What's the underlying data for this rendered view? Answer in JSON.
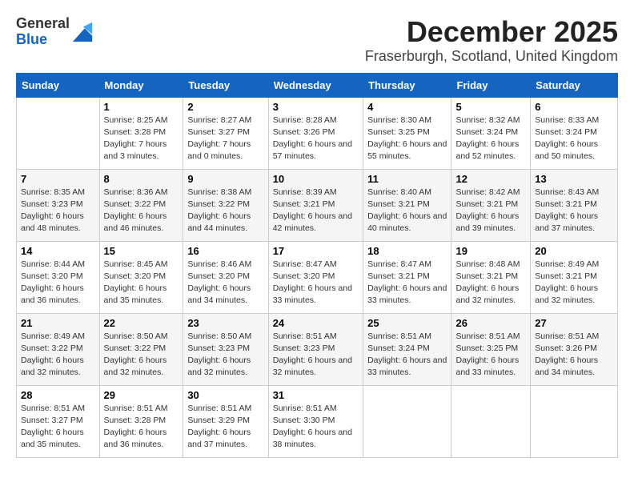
{
  "header": {
    "logo_general": "General",
    "logo_blue": "Blue",
    "title": "December 2025",
    "subtitle": "Fraserburgh, Scotland, United Kingdom"
  },
  "weekdays": [
    "Sunday",
    "Monday",
    "Tuesday",
    "Wednesday",
    "Thursday",
    "Friday",
    "Saturday"
  ],
  "weeks": [
    [
      {
        "day": "",
        "sunrise": "",
        "sunset": "",
        "daylight": ""
      },
      {
        "day": "1",
        "sunrise": "8:25 AM",
        "sunset": "3:28 PM",
        "daylight": "7 hours and 3 minutes."
      },
      {
        "day": "2",
        "sunrise": "8:27 AM",
        "sunset": "3:27 PM",
        "daylight": "7 hours and 0 minutes."
      },
      {
        "day": "3",
        "sunrise": "8:28 AM",
        "sunset": "3:26 PM",
        "daylight": "6 hours and 57 minutes."
      },
      {
        "day": "4",
        "sunrise": "8:30 AM",
        "sunset": "3:25 PM",
        "daylight": "6 hours and 55 minutes."
      },
      {
        "day": "5",
        "sunrise": "8:32 AM",
        "sunset": "3:24 PM",
        "daylight": "6 hours and 52 minutes."
      },
      {
        "day": "6",
        "sunrise": "8:33 AM",
        "sunset": "3:24 PM",
        "daylight": "6 hours and 50 minutes."
      }
    ],
    [
      {
        "day": "7",
        "sunrise": "8:35 AM",
        "sunset": "3:23 PM",
        "daylight": "6 hours and 48 minutes."
      },
      {
        "day": "8",
        "sunrise": "8:36 AM",
        "sunset": "3:22 PM",
        "daylight": "6 hours and 46 minutes."
      },
      {
        "day": "9",
        "sunrise": "8:38 AM",
        "sunset": "3:22 PM",
        "daylight": "6 hours and 44 minutes."
      },
      {
        "day": "10",
        "sunrise": "8:39 AM",
        "sunset": "3:21 PM",
        "daylight": "6 hours and 42 minutes."
      },
      {
        "day": "11",
        "sunrise": "8:40 AM",
        "sunset": "3:21 PM",
        "daylight": "6 hours and 40 minutes."
      },
      {
        "day": "12",
        "sunrise": "8:42 AM",
        "sunset": "3:21 PM",
        "daylight": "6 hours and 39 minutes."
      },
      {
        "day": "13",
        "sunrise": "8:43 AM",
        "sunset": "3:21 PM",
        "daylight": "6 hours and 37 minutes."
      }
    ],
    [
      {
        "day": "14",
        "sunrise": "8:44 AM",
        "sunset": "3:20 PM",
        "daylight": "6 hours and 36 minutes."
      },
      {
        "day": "15",
        "sunrise": "8:45 AM",
        "sunset": "3:20 PM",
        "daylight": "6 hours and 35 minutes."
      },
      {
        "day": "16",
        "sunrise": "8:46 AM",
        "sunset": "3:20 PM",
        "daylight": "6 hours and 34 minutes."
      },
      {
        "day": "17",
        "sunrise": "8:47 AM",
        "sunset": "3:20 PM",
        "daylight": "6 hours and 33 minutes."
      },
      {
        "day": "18",
        "sunrise": "8:47 AM",
        "sunset": "3:21 PM",
        "daylight": "6 hours and 33 minutes."
      },
      {
        "day": "19",
        "sunrise": "8:48 AM",
        "sunset": "3:21 PM",
        "daylight": "6 hours and 32 minutes."
      },
      {
        "day": "20",
        "sunrise": "8:49 AM",
        "sunset": "3:21 PM",
        "daylight": "6 hours and 32 minutes."
      }
    ],
    [
      {
        "day": "21",
        "sunrise": "8:49 AM",
        "sunset": "3:22 PM",
        "daylight": "6 hours and 32 minutes."
      },
      {
        "day": "22",
        "sunrise": "8:50 AM",
        "sunset": "3:22 PM",
        "daylight": "6 hours and 32 minutes."
      },
      {
        "day": "23",
        "sunrise": "8:50 AM",
        "sunset": "3:23 PM",
        "daylight": "6 hours and 32 minutes."
      },
      {
        "day": "24",
        "sunrise": "8:51 AM",
        "sunset": "3:23 PM",
        "daylight": "6 hours and 32 minutes."
      },
      {
        "day": "25",
        "sunrise": "8:51 AM",
        "sunset": "3:24 PM",
        "daylight": "6 hours and 33 minutes."
      },
      {
        "day": "26",
        "sunrise": "8:51 AM",
        "sunset": "3:25 PM",
        "daylight": "6 hours and 33 minutes."
      },
      {
        "day": "27",
        "sunrise": "8:51 AM",
        "sunset": "3:26 PM",
        "daylight": "6 hours and 34 minutes."
      }
    ],
    [
      {
        "day": "28",
        "sunrise": "8:51 AM",
        "sunset": "3:27 PM",
        "daylight": "6 hours and 35 minutes."
      },
      {
        "day": "29",
        "sunrise": "8:51 AM",
        "sunset": "3:28 PM",
        "daylight": "6 hours and 36 minutes."
      },
      {
        "day": "30",
        "sunrise": "8:51 AM",
        "sunset": "3:29 PM",
        "daylight": "6 hours and 37 minutes."
      },
      {
        "day": "31",
        "sunrise": "8:51 AM",
        "sunset": "3:30 PM",
        "daylight": "6 hours and 38 minutes."
      },
      {
        "day": "",
        "sunrise": "",
        "sunset": "",
        "daylight": ""
      },
      {
        "day": "",
        "sunrise": "",
        "sunset": "",
        "daylight": ""
      },
      {
        "day": "",
        "sunrise": "",
        "sunset": "",
        "daylight": ""
      }
    ]
  ]
}
